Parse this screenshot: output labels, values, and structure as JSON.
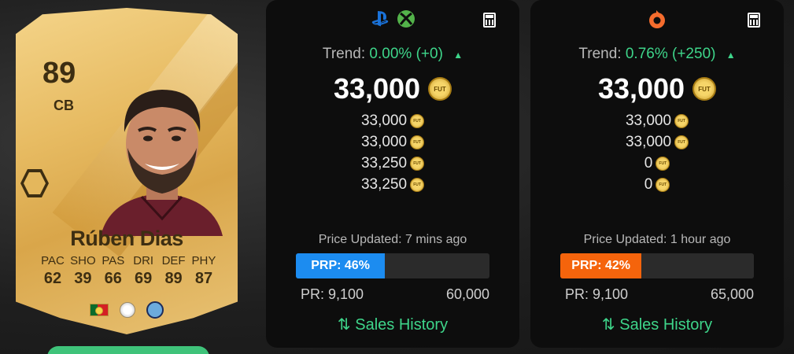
{
  "card": {
    "rating": "89",
    "position": "CB",
    "name": "Rúben Dias",
    "stats": [
      {
        "label": "PAC",
        "value": "62"
      },
      {
        "label": "SHO",
        "value": "39"
      },
      {
        "label": "PAS",
        "value": "66"
      },
      {
        "label": "DRI",
        "value": "69"
      },
      {
        "label": "DEF",
        "value": "89"
      },
      {
        "label": "PHY",
        "value": "87"
      }
    ],
    "nation_icon": "portugal-flag-icon",
    "league_icon": "premier-league-icon",
    "club_icon": "manchester-city-icon"
  },
  "panels": [
    {
      "platforms": [
        "playstation-icon",
        "xbox-icon"
      ],
      "trend_label": "Trend:",
      "trend_value": "0.00% (+0)",
      "trend_arrow": "▲",
      "main_price": "33,000",
      "prices": [
        "33,000",
        "33,000",
        "33,250",
        "33,250"
      ],
      "updated": "Price Updated: 7 mins ago",
      "prp_label": "PRP: 46%",
      "prp_fraction": 0.46,
      "prp_color": "#1c8cf0",
      "pr_label": "PR: 9,100",
      "pr_max": "60,000",
      "sales_label": "Sales History"
    },
    {
      "platforms": [
        "origin-pc-icon"
      ],
      "trend_label": "Trend:",
      "trend_value": "0.76% (+250)",
      "trend_arrow": "▲",
      "main_price": "33,000",
      "prices": [
        "33,000",
        "33,000",
        "0",
        "0"
      ],
      "updated": "Price Updated: 1 hour ago",
      "prp_label": "PRP: 42%",
      "prp_fraction": 0.42,
      "prp_color": "#f5640c",
      "pr_label": "PR: 9,100",
      "pr_max": "65,000",
      "sales_label": "Sales History"
    }
  ],
  "coin_text": "FUT",
  "colors": {
    "accent_green": "#3ed58a",
    "panel_bg": "#0d0d0d"
  }
}
